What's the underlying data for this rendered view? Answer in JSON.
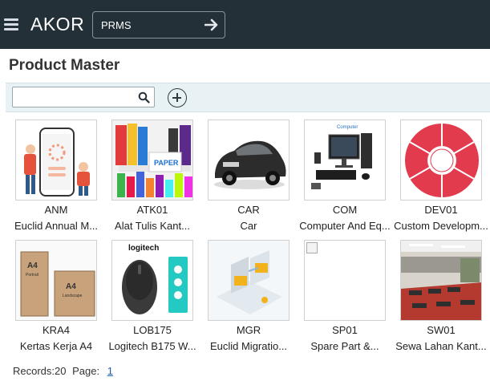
{
  "app": {
    "brand": "AKOR",
    "module": "PRMS"
  },
  "page": {
    "title": "Product Master"
  },
  "toolbar": {
    "search_value": "",
    "search_placeholder": ""
  },
  "products": [
    {
      "code": "ANM",
      "name": "Euclid Annual M..."
    },
    {
      "code": "ATK01",
      "name": "Alat Tulis Kant..."
    },
    {
      "code": "CAR",
      "name": "Car"
    },
    {
      "code": "COM",
      "name": "Computer And Eq..."
    },
    {
      "code": "DEV01",
      "name": "Custom Developm..."
    },
    {
      "code": "KRA4",
      "name": "Kertas Kerja A4"
    },
    {
      "code": "LOB175",
      "name": "Logitech B175 W..."
    },
    {
      "code": "MGR",
      "name": "Euclid Migratio..."
    },
    {
      "code": "SP01",
      "name": "Spare Part &..."
    },
    {
      "code": "SW01",
      "name": "Sewa Lahan Kant..."
    }
  ],
  "thumb_text": {
    "computer": "Computer",
    "paper": "PAPER",
    "a4": "A4",
    "portrait": "Portrait",
    "landscape": "Landscape",
    "logitech": "logitech"
  },
  "footer": {
    "records_label": "Records:20",
    "page_label": "Page:",
    "page_number": "1"
  },
  "colors": {
    "topbar": "#243038",
    "toolbar": "#e8f2f5",
    "link": "#1f5fa8"
  },
  "icons": [
    "menu-icon",
    "arrow-right-icon",
    "search-icon",
    "add-circle-icon"
  ]
}
